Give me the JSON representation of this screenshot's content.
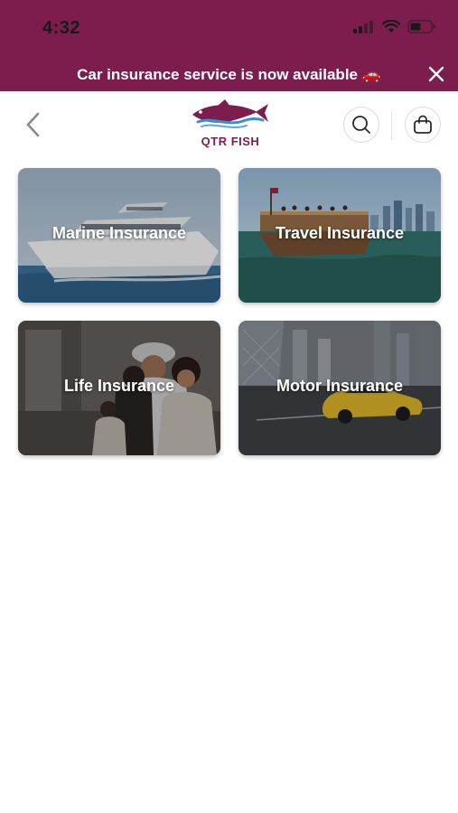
{
  "status_bar": {
    "time": "4:32"
  },
  "banner": {
    "text": "Car insurance service is now available 🚗"
  },
  "header": {
    "logo_text": "QTR FISH"
  },
  "categories": [
    {
      "label": "Marine Insurance"
    },
    {
      "label": "Travel Insurance"
    },
    {
      "label": "Life Insurance"
    },
    {
      "label": "Motor Insurance"
    }
  ],
  "colors": {
    "brand": "#7d1d4e",
    "logo_blue": "#3a8fd0"
  }
}
